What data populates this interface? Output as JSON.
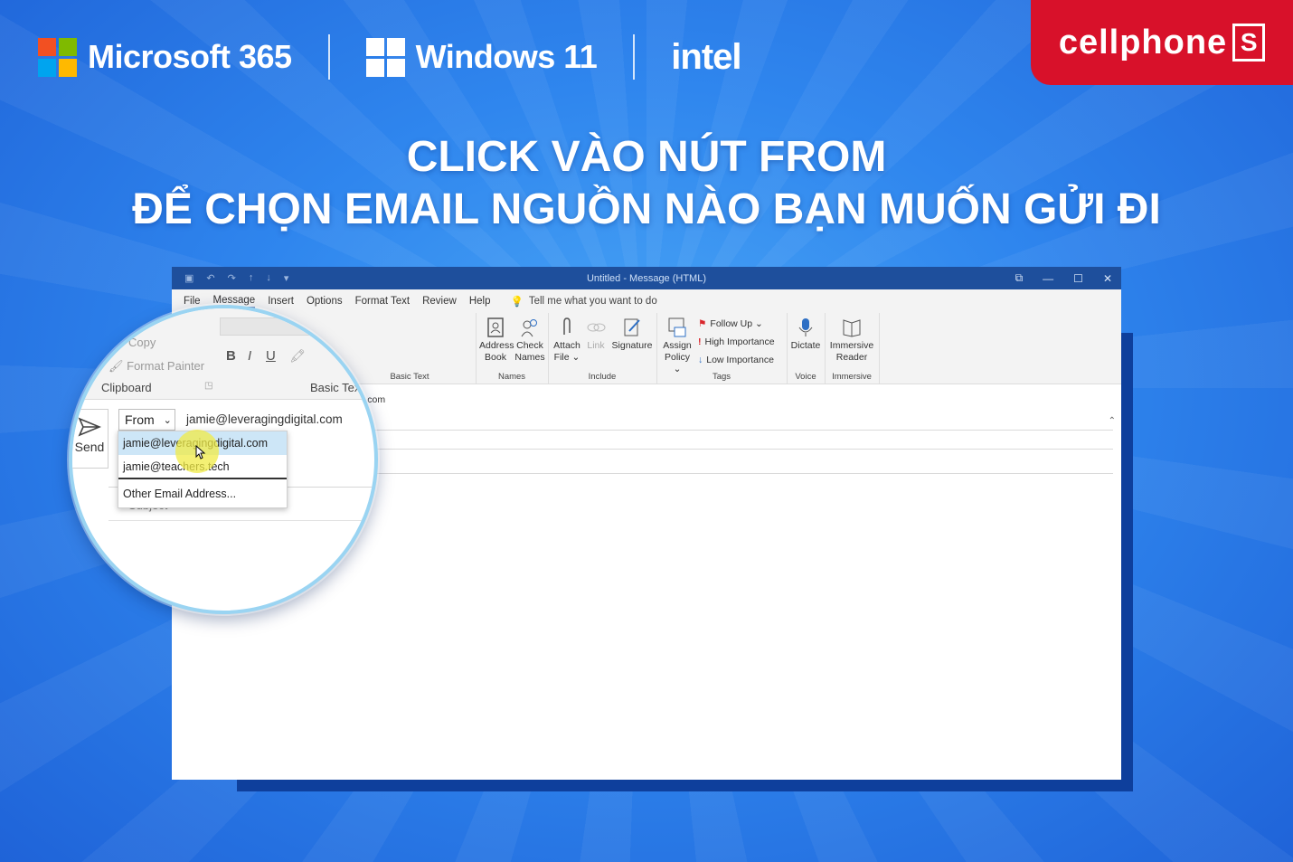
{
  "brand": {
    "microsoft": "Microsoft 365",
    "windows": "Windows 11",
    "intel": "intel",
    "cellphone": "cellphone",
    "cellphone_s": "S",
    "ms_colors": [
      "#f25022",
      "#7fba00",
      "#00a4ef",
      "#ffb900"
    ]
  },
  "headline": {
    "line1": "CLICK VÀO NÚT FROM",
    "line2": "ĐỂ CHỌN EMAIL NGUỒN NÀO BẠN MUỐN GỬI ĐI"
  },
  "window": {
    "title": "Untitled  -  Message (HTML)"
  },
  "menu": {
    "items": [
      "File",
      "Message",
      "Insert",
      "Options",
      "Format Text",
      "Review",
      "Help"
    ],
    "tell_me": "Tell me what you want to do"
  },
  "ribbon": {
    "groups": {
      "clipboard": "Clipboard",
      "basic_text": "Basic Text",
      "names": "Names",
      "include": "Include",
      "tags": "Tags",
      "voice": "Voice",
      "immersive": "Immersive"
    },
    "buttons": {
      "copy": "Copy",
      "format_painter": "Format Painter",
      "address_book_1": "Address",
      "address_book_2": "Book",
      "check_names_1": "Check",
      "check_names_2": "Names",
      "attach_1": "Attach",
      "attach_2": "File ⌄",
      "link": "Link",
      "signature": "Signature",
      "assign_1": "Assign",
      "assign_2": "Policy ⌄",
      "follow_up": "Follow Up ⌄",
      "high_importance": "High Importance",
      "low_importance": "Low Importance",
      "dictate": "Dictate",
      "immersive_1": "Immersive",
      "immersive_2": "Reader"
    }
  },
  "compose": {
    "send": "Send",
    "from_label": "From",
    "from_value": "jamie@leveragingdigital.com",
    "to_partial": "l.com",
    "subject_partial": "Subject",
    "dropdown_options": [
      "jamie@leveragingdigital.com",
      "jamie@teachers.tech",
      "Other Email Address..."
    ]
  }
}
